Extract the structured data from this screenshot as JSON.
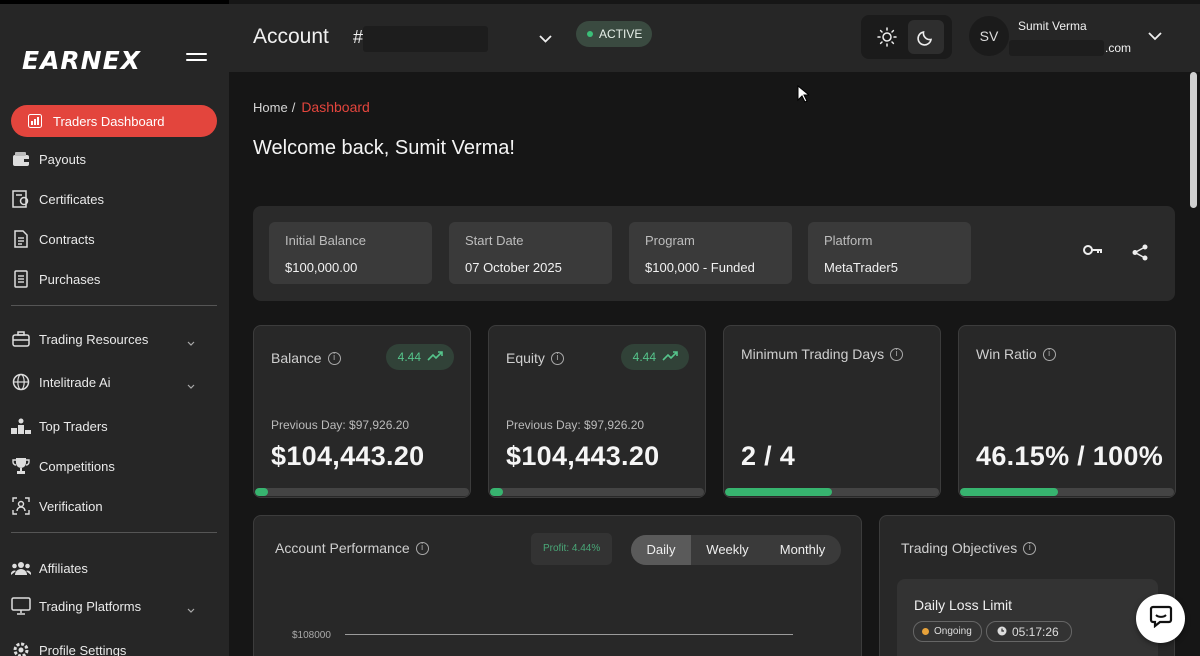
{
  "brand": {
    "logo_text": "EARNEX"
  },
  "sidebar": {
    "items": [
      {
        "label": "Traders Dashboard",
        "icon": "chart-icon",
        "active": true
      },
      {
        "label": "Payouts",
        "icon": "wallet-icon"
      },
      {
        "label": "Certificates",
        "icon": "certificate-icon"
      },
      {
        "label": "Contracts",
        "icon": "document-icon"
      },
      {
        "label": "Purchases",
        "icon": "receipt-icon"
      },
      {
        "label": "Trading Resources",
        "icon": "briefcase-icon",
        "expandable": true
      },
      {
        "label": "Intelitrade Ai",
        "icon": "globe-icon",
        "expandable": true
      },
      {
        "label": "Top Traders",
        "icon": "podium-icon"
      },
      {
        "label": "Competitions",
        "icon": "trophy-icon"
      },
      {
        "label": "Verification",
        "icon": "face-scan-icon"
      },
      {
        "label": "Affiliates",
        "icon": "users-icon"
      },
      {
        "label": "Trading Platforms",
        "icon": "monitor-icon",
        "expandable": true
      },
      {
        "label": "Profile Settings",
        "icon": "gear-icon"
      }
    ]
  },
  "header": {
    "title": "Account",
    "account_prefix": "#",
    "status": "ACTIVE",
    "user": {
      "initials": "SV",
      "name": "Sumit Verma",
      "email_suffix": ".com"
    }
  },
  "breadcrumb": {
    "home": "Home",
    "separator": "/",
    "current": "Dashboard"
  },
  "welcome": "Welcome back, Sumit Verma!",
  "account_info": [
    {
      "label": "Initial Balance",
      "value": "$100,000.00"
    },
    {
      "label": "Start Date",
      "value": "07 October 2025"
    },
    {
      "label": "Program",
      "value": "$100,000 - Funded"
    },
    {
      "label": "Platform",
      "value": "MetaTrader5"
    }
  ],
  "stats": {
    "balance": {
      "title": "Balance",
      "change": "4.44",
      "previous": "Previous Day: $97,926.20",
      "value": "$104,443.20",
      "progress": 0.06
    },
    "equity": {
      "title": "Equity",
      "change": "4.44",
      "previous": "Previous Day: $97,926.20",
      "value": "$104,443.20",
      "progress": 0.06
    },
    "min_days": {
      "title": "Minimum Trading Days",
      "value": "2 / 4",
      "progress": 0.5
    },
    "win_ratio": {
      "title": "Win Ratio",
      "value": "46.15% / 100%",
      "progress": 0.46
    }
  },
  "performance": {
    "title": "Account Performance",
    "profit": "Profit: 4.44%",
    "tabs": [
      "Daily",
      "Weekly",
      "Monthly"
    ],
    "active_tab": "Daily",
    "y_tick": "$108000"
  },
  "objectives": {
    "title": "Trading Objectives",
    "items": [
      {
        "title": "Daily Loss Limit",
        "status": "Ongoing",
        "timer": "05:17:26"
      }
    ]
  },
  "colors": {
    "accent": "#e3453d",
    "success": "#37b46f",
    "background": "#161616",
    "panel": "#262626"
  }
}
